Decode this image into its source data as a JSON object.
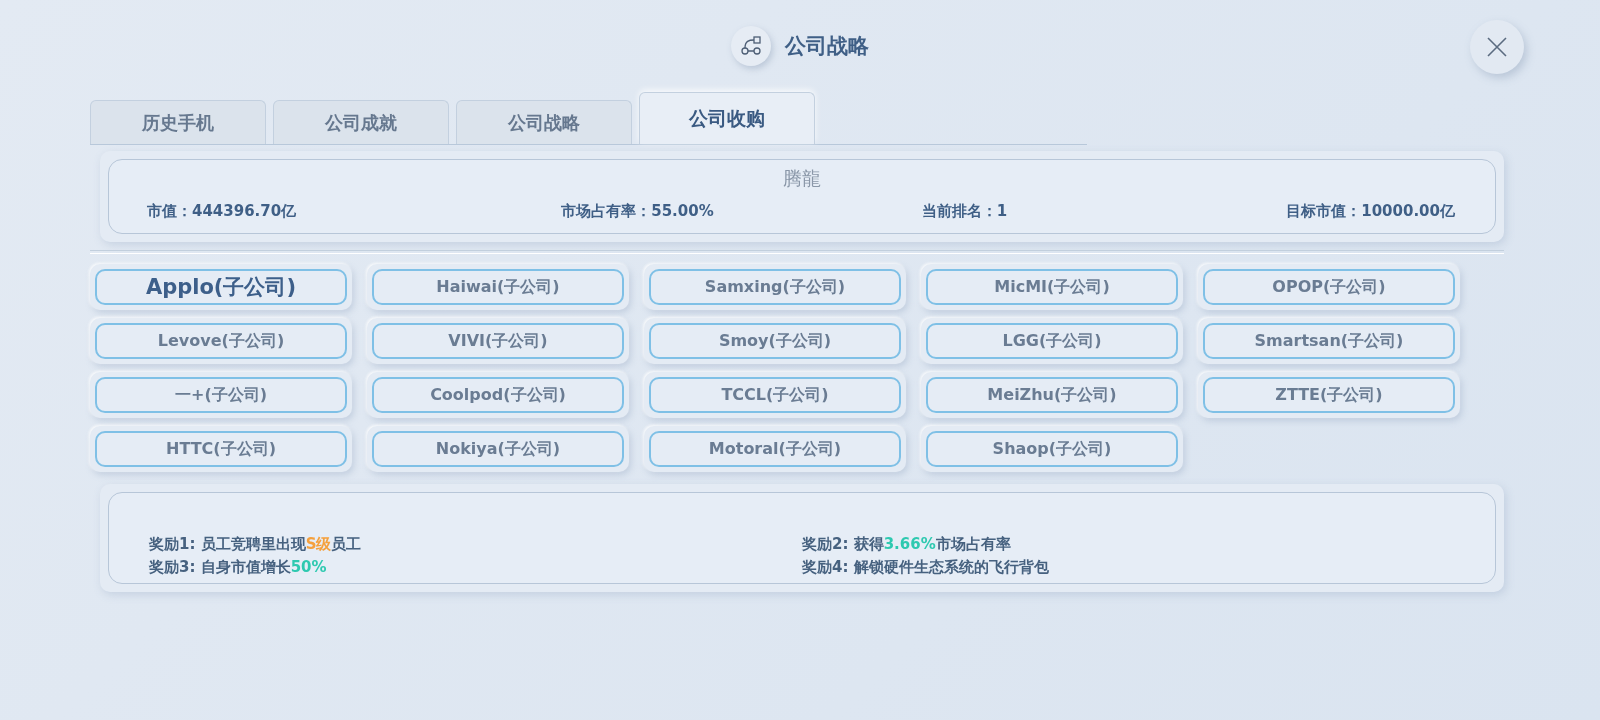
{
  "title": "公司战略",
  "tabs": [
    {
      "label": "历史手机",
      "selected": false
    },
    {
      "label": "公司成就",
      "selected": false
    },
    {
      "label": "公司战略",
      "selected": false
    },
    {
      "label": "公司收购",
      "selected": true
    }
  ],
  "company": {
    "name": "腾龍",
    "stats": [
      "市值：444396.70亿",
      "市场占有率：55.00%",
      "当前排名：1",
      "目标市值：10000.00亿"
    ]
  },
  "subsidiaries": [
    {
      "label": "Applo(子公司)",
      "selected": true
    },
    {
      "label": "Haiwai(子公司)",
      "selected": false
    },
    {
      "label": "Samxing(子公司)",
      "selected": false
    },
    {
      "label": "MicMI(子公司)",
      "selected": false
    },
    {
      "label": "OPOP(子公司)",
      "selected": false
    },
    {
      "label": "Levove(子公司)",
      "selected": false
    },
    {
      "label": "VIVI(子公司)",
      "selected": false
    },
    {
      "label": "Smoy(子公司)",
      "selected": false
    },
    {
      "label": "LGG(子公司)",
      "selected": false
    },
    {
      "label": "Smartsan(子公司)",
      "selected": false
    },
    {
      "label": "一+(子公司)",
      "selected": false
    },
    {
      "label": "Coolpod(子公司)",
      "selected": false
    },
    {
      "label": "TCCL(子公司)",
      "selected": false
    },
    {
      "label": "MeiZhu(子公司)",
      "selected": false
    },
    {
      "label": "ZTTE(子公司)",
      "selected": false
    },
    {
      "label": "HTTC(子公司)",
      "selected": false
    },
    {
      "label": "Nokiya(子公司)",
      "selected": false
    },
    {
      "label": "Motoral(子公司)",
      "selected": false
    },
    {
      "label": "Shaop(子公司)",
      "selected": false
    }
  ],
  "rewards": [
    [
      {
        "text": "奖励1: 员工竞聘里出现"
      },
      {
        "text": "S级",
        "color": "#f5a03c"
      },
      {
        "text": "员工"
      }
    ],
    [
      {
        "text": "奖励2: 获得"
      },
      {
        "text": "3.66%",
        "color": "#2ec9b0"
      },
      {
        "text": "市场占有率"
      }
    ],
    [
      {
        "text": "奖励3: 自身市值增长"
      },
      {
        "text": "50%",
        "color": "#2ec9b0"
      }
    ],
    [
      {
        "text": "奖励4: 解锁硬件生态系统的飞行背包"
      }
    ]
  ]
}
